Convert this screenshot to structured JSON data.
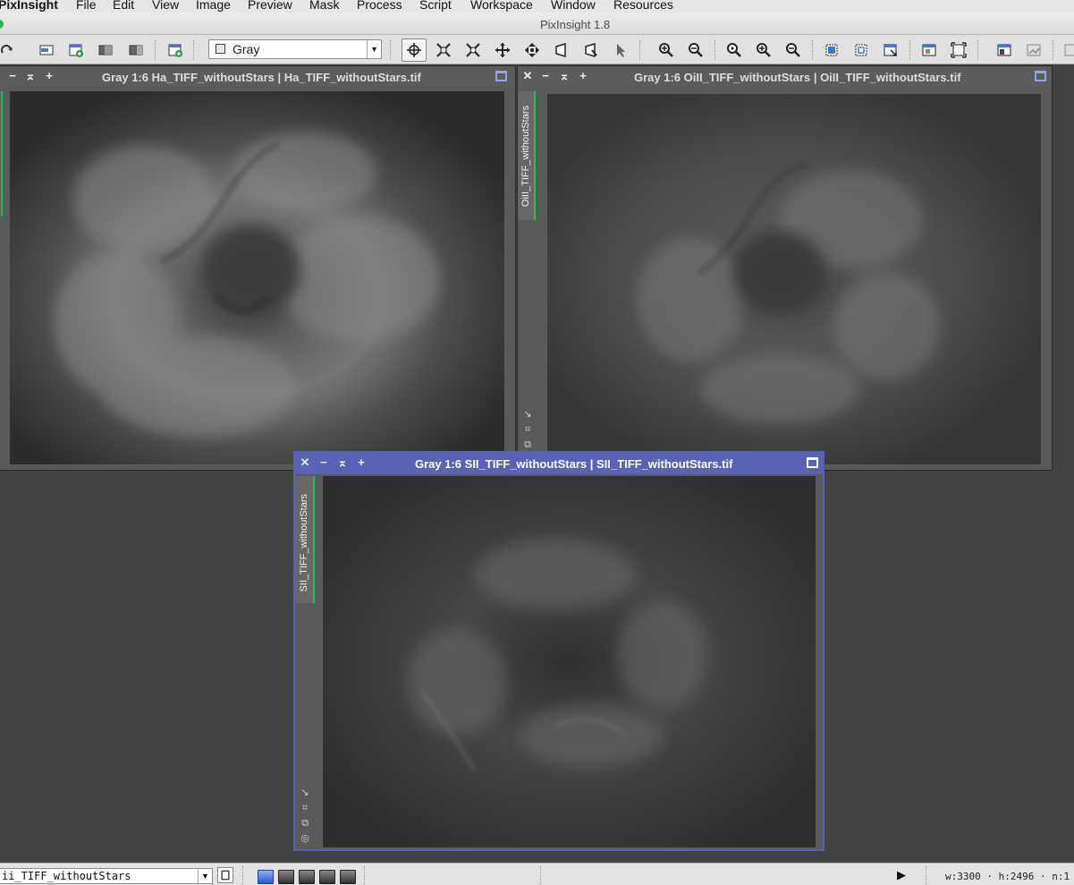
{
  "menubar": {
    "app_name": "PixInsight",
    "items": [
      "File",
      "Edit",
      "View",
      "Image",
      "Preview",
      "Mask",
      "Process",
      "Script",
      "Workspace",
      "Window",
      "Resources"
    ]
  },
  "app_title": "PixInsight 1.8",
  "toolbar": {
    "channel_select": "Gray",
    "icons": [
      "redo-icon",
      "new-image-icon",
      "duplicate-icon",
      "close-image-icon",
      "close-all-icon",
      "new-window-icon",
      "readout-mode-icon",
      "fit-view-icon",
      "zoom-fit-icon",
      "pan-mode-icon",
      "move-icon",
      "crop-icon",
      "preview-mode-icon",
      "pointer-icon",
      "zoom-in-icon",
      "zoom-out-icon",
      "zoom-1to1-icon",
      "zoom-in-alt-icon",
      "zoom-out-alt-icon",
      "new-preview-icon",
      "edit-preview-icon",
      "preview-export-icon",
      "mask-window-icon",
      "fit-window-icon",
      "stf-icon",
      "stf-auto-icon"
    ]
  },
  "windows": {
    "ha": {
      "title": "Gray 1:6 Ha_TIFF_withoutStars | Ha_TIFF_withoutStars.tif"
    },
    "oiii": {
      "title": "Gray 1:6 OiII_TIFF_withoutStars | OiII_TIFF_withoutStars.tif",
      "tab_label": "OiII_TIFF_withoutStars"
    },
    "sii": {
      "title": "Gray 1:6 SII_TIFF_withoutStars | SII_TIFF_withoutStars.tif",
      "tab_label": "SII_TIFF_withoutStars"
    }
  },
  "statusbar": {
    "view_selector": "ii_TIFF_withoutStars",
    "readout": "w:3300 · h:2496 · n:1"
  }
}
